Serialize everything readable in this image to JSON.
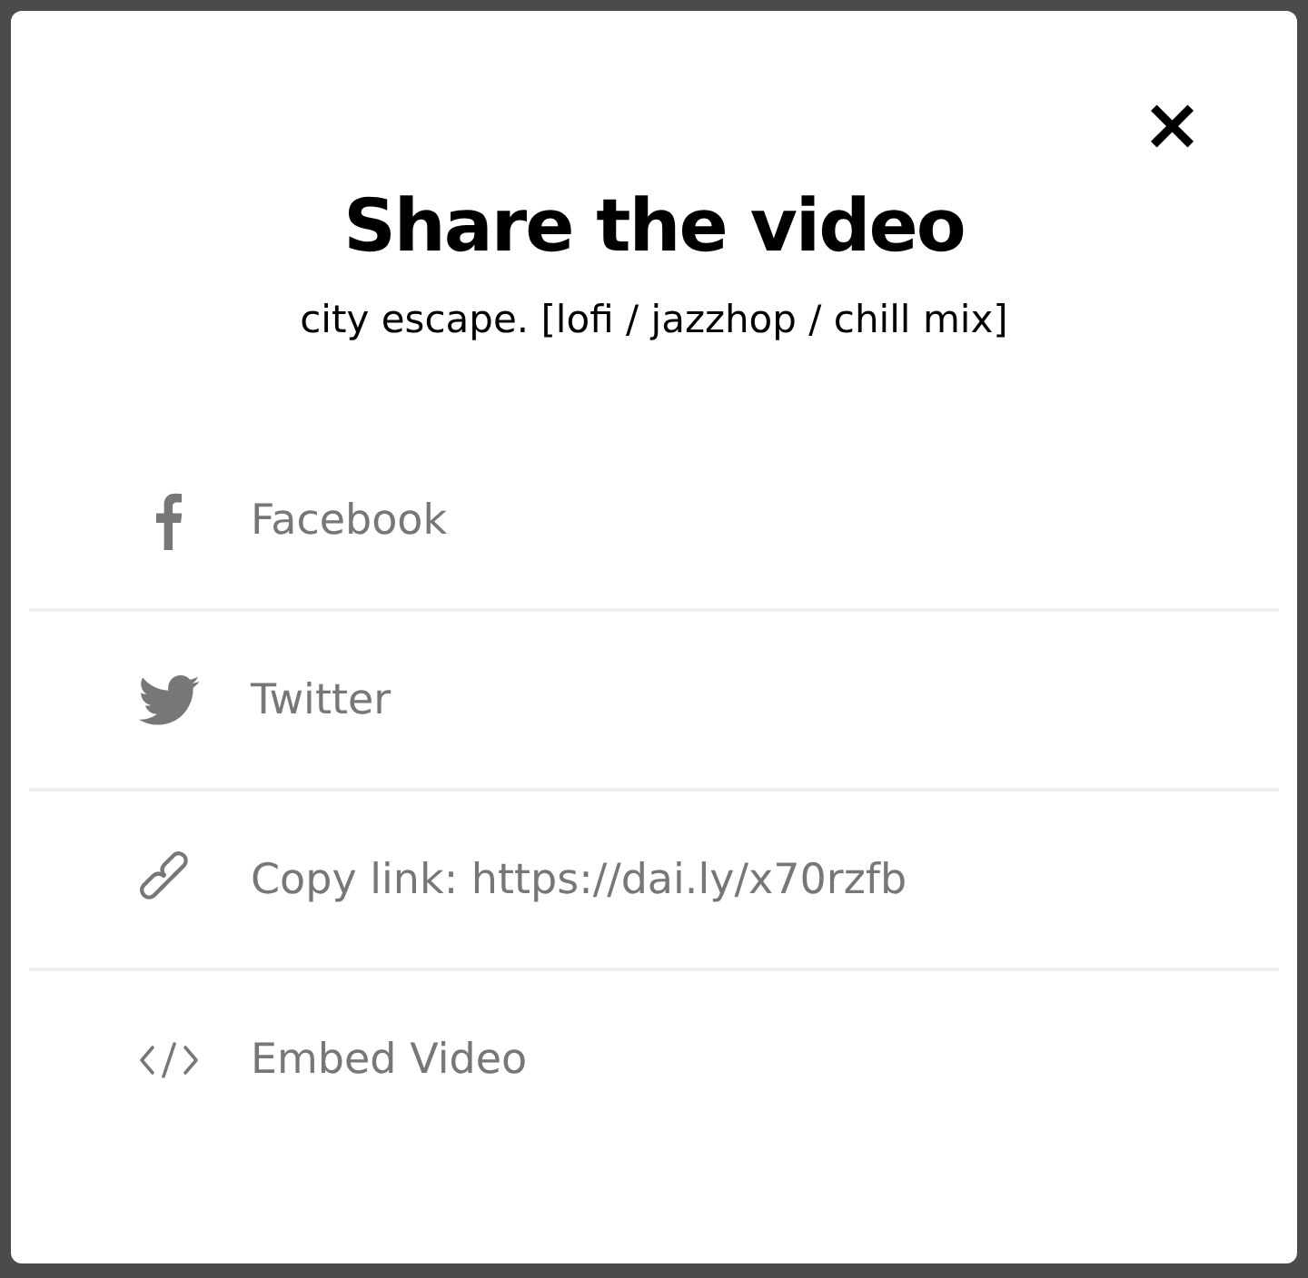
{
  "dialog": {
    "close": "×",
    "title": "Share the video",
    "subtitle": "city escape. [lofi / jazzhop / chill mix]"
  },
  "options": [
    {
      "kind": "facebook",
      "label": "Facebook"
    },
    {
      "kind": "twitter",
      "label": "Twitter"
    },
    {
      "kind": "link",
      "label": "Copy link: https://dai.ly/x70rzfb"
    },
    {
      "kind": "embed",
      "label": "Embed Video"
    }
  ]
}
